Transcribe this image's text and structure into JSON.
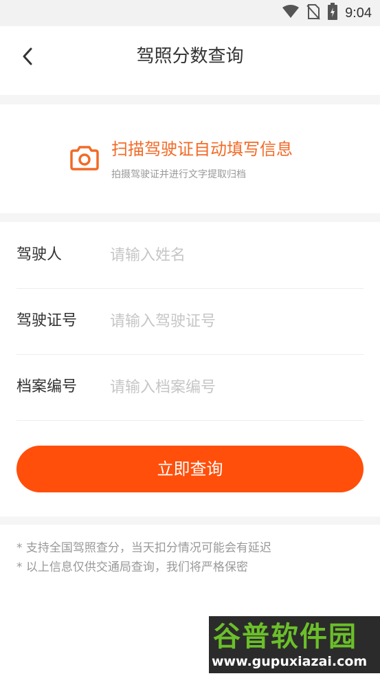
{
  "status_bar": {
    "time": "9:04",
    "icons": [
      "wifi-icon",
      "no-sim-icon",
      "battery-charging-icon"
    ]
  },
  "header": {
    "back_icon": "chevron-left-icon",
    "title": "驾照分数查询"
  },
  "scan": {
    "icon": "camera-icon",
    "title": "扫描驾驶证自动填写信息",
    "subtitle": "拍摄驾驶证并进行文字提取归档",
    "accent_color": "#f26a27"
  },
  "form": {
    "fields": [
      {
        "label": "驾驶人",
        "placeholder": "请输入姓名",
        "value": ""
      },
      {
        "label": "驾驶证号",
        "placeholder": "请输入驾驶证号",
        "value": ""
      },
      {
        "label": "档案编号",
        "placeholder": "请输入档案编号",
        "value": ""
      }
    ],
    "submit_label": "立即查询",
    "button_color": "#ff4f0a"
  },
  "notes": [
    "* 支持全国驾照查分，当天扣分情况可能会有延迟",
    "* 以上信息仅供交通局查询，我们将严格保密"
  ],
  "watermark": {
    "title": "谷普软件园",
    "url": "www.gupuxiazai.com"
  }
}
